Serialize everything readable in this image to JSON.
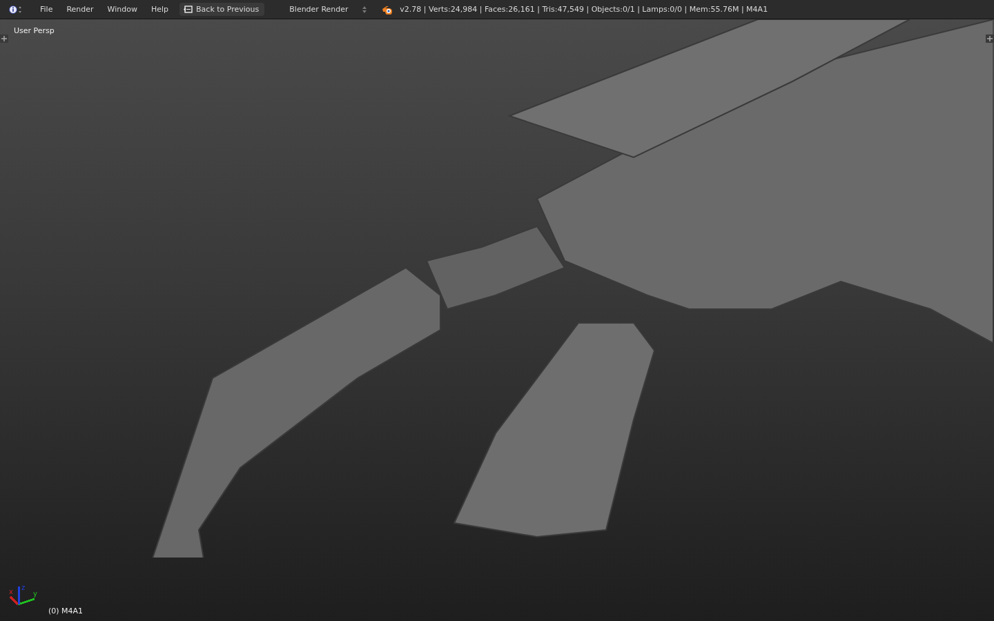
{
  "header": {
    "menus": [
      "File",
      "Render",
      "Window",
      "Help"
    ],
    "back_button": "Back to Previous",
    "render_engine": "Blender Render",
    "stats": "v2.78 | Verts:24,984 | Faces:26,161 | Tris:47,549 | Objects:0/1 | Lamps:0/0 | Mem:55.76M | M4A1"
  },
  "viewport": {
    "view_name": "User Persp",
    "object_label": "(0) M4A1",
    "axes": [
      {
        "label": "x",
        "color": "#cc2020"
      },
      {
        "label": "z",
        "color": "#2040e0"
      },
      {
        "label": "y",
        "color": "#20c020"
      }
    ]
  }
}
